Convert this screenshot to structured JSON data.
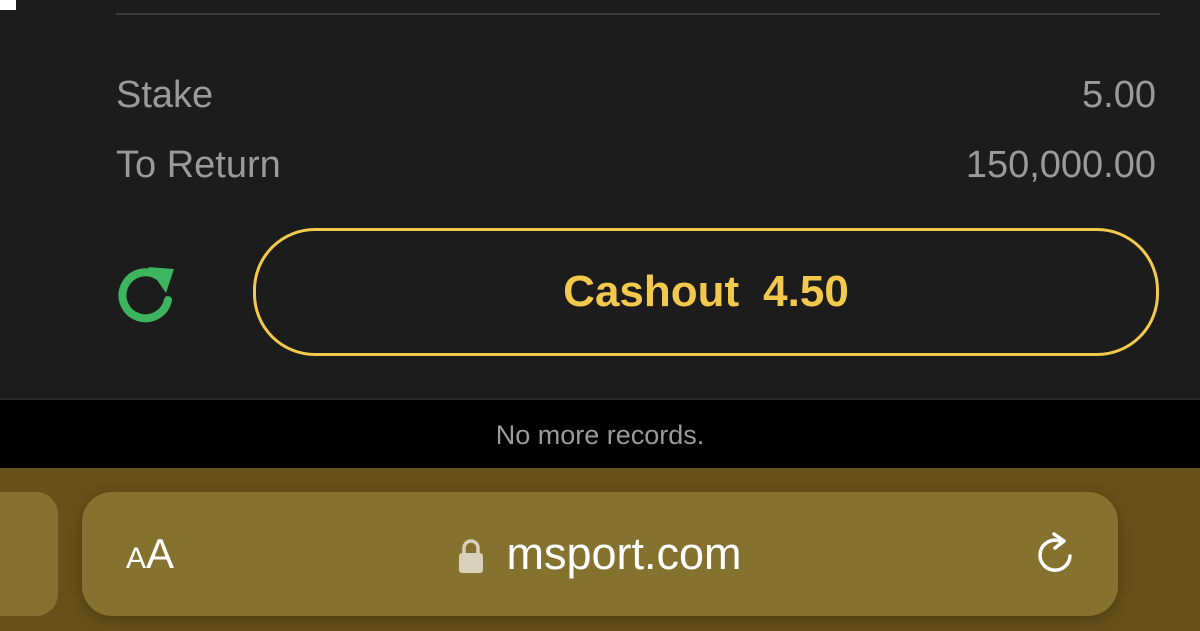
{
  "bet": {
    "stake_label": "Stake",
    "stake_value": "5.00",
    "return_label": "To Return",
    "return_value": "150,000.00",
    "cashout_label": "Cashout",
    "cashout_amount": "4.50"
  },
  "list": {
    "end_message": "No more records."
  },
  "browser": {
    "text_size_small": "A",
    "text_size_large": "A",
    "url": "msport.com"
  },
  "icons": {
    "refresh": "refresh-icon",
    "lock": "lock-icon",
    "reload": "reload-icon"
  },
  "colors": {
    "accent_yellow": "#f2c94c",
    "refresh_green": "#3db45e",
    "card_background": "#1c1c1c",
    "browser_bar": "#67511a"
  }
}
